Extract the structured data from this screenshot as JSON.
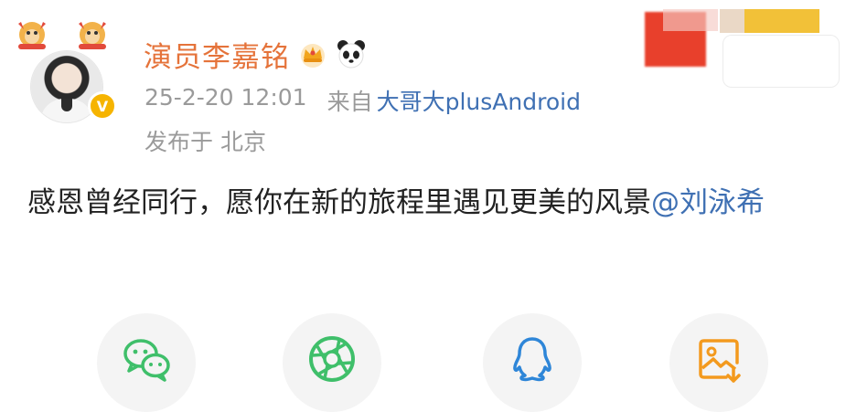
{
  "post": {
    "author_name": "演员李嘉铭",
    "timestamp": "25-2-20 12:01",
    "source_prefix": "来自",
    "source_client": "大哥大plusAndroid",
    "location": "发布于 北京",
    "text": "感恩曾经同行，愿你在新的旅程里遇见更美的风景",
    "mention": "@刘泳希"
  },
  "icons": {
    "crown": "crown-icon",
    "panda": "panda-icon",
    "verified": "verified-badge-icon",
    "share": [
      "wechat-icon",
      "moments-icon",
      "qq-icon",
      "save-image-icon"
    ]
  },
  "colors": {
    "author_name": "#e5733a",
    "link": "#3f70b3",
    "meta": "#9a9a9a",
    "text": "#222222",
    "share_bg": "#f4f4f4",
    "share_green": "#3fbf6a",
    "share_blue": "#2e86d8",
    "share_orange": "#f39a1e"
  }
}
